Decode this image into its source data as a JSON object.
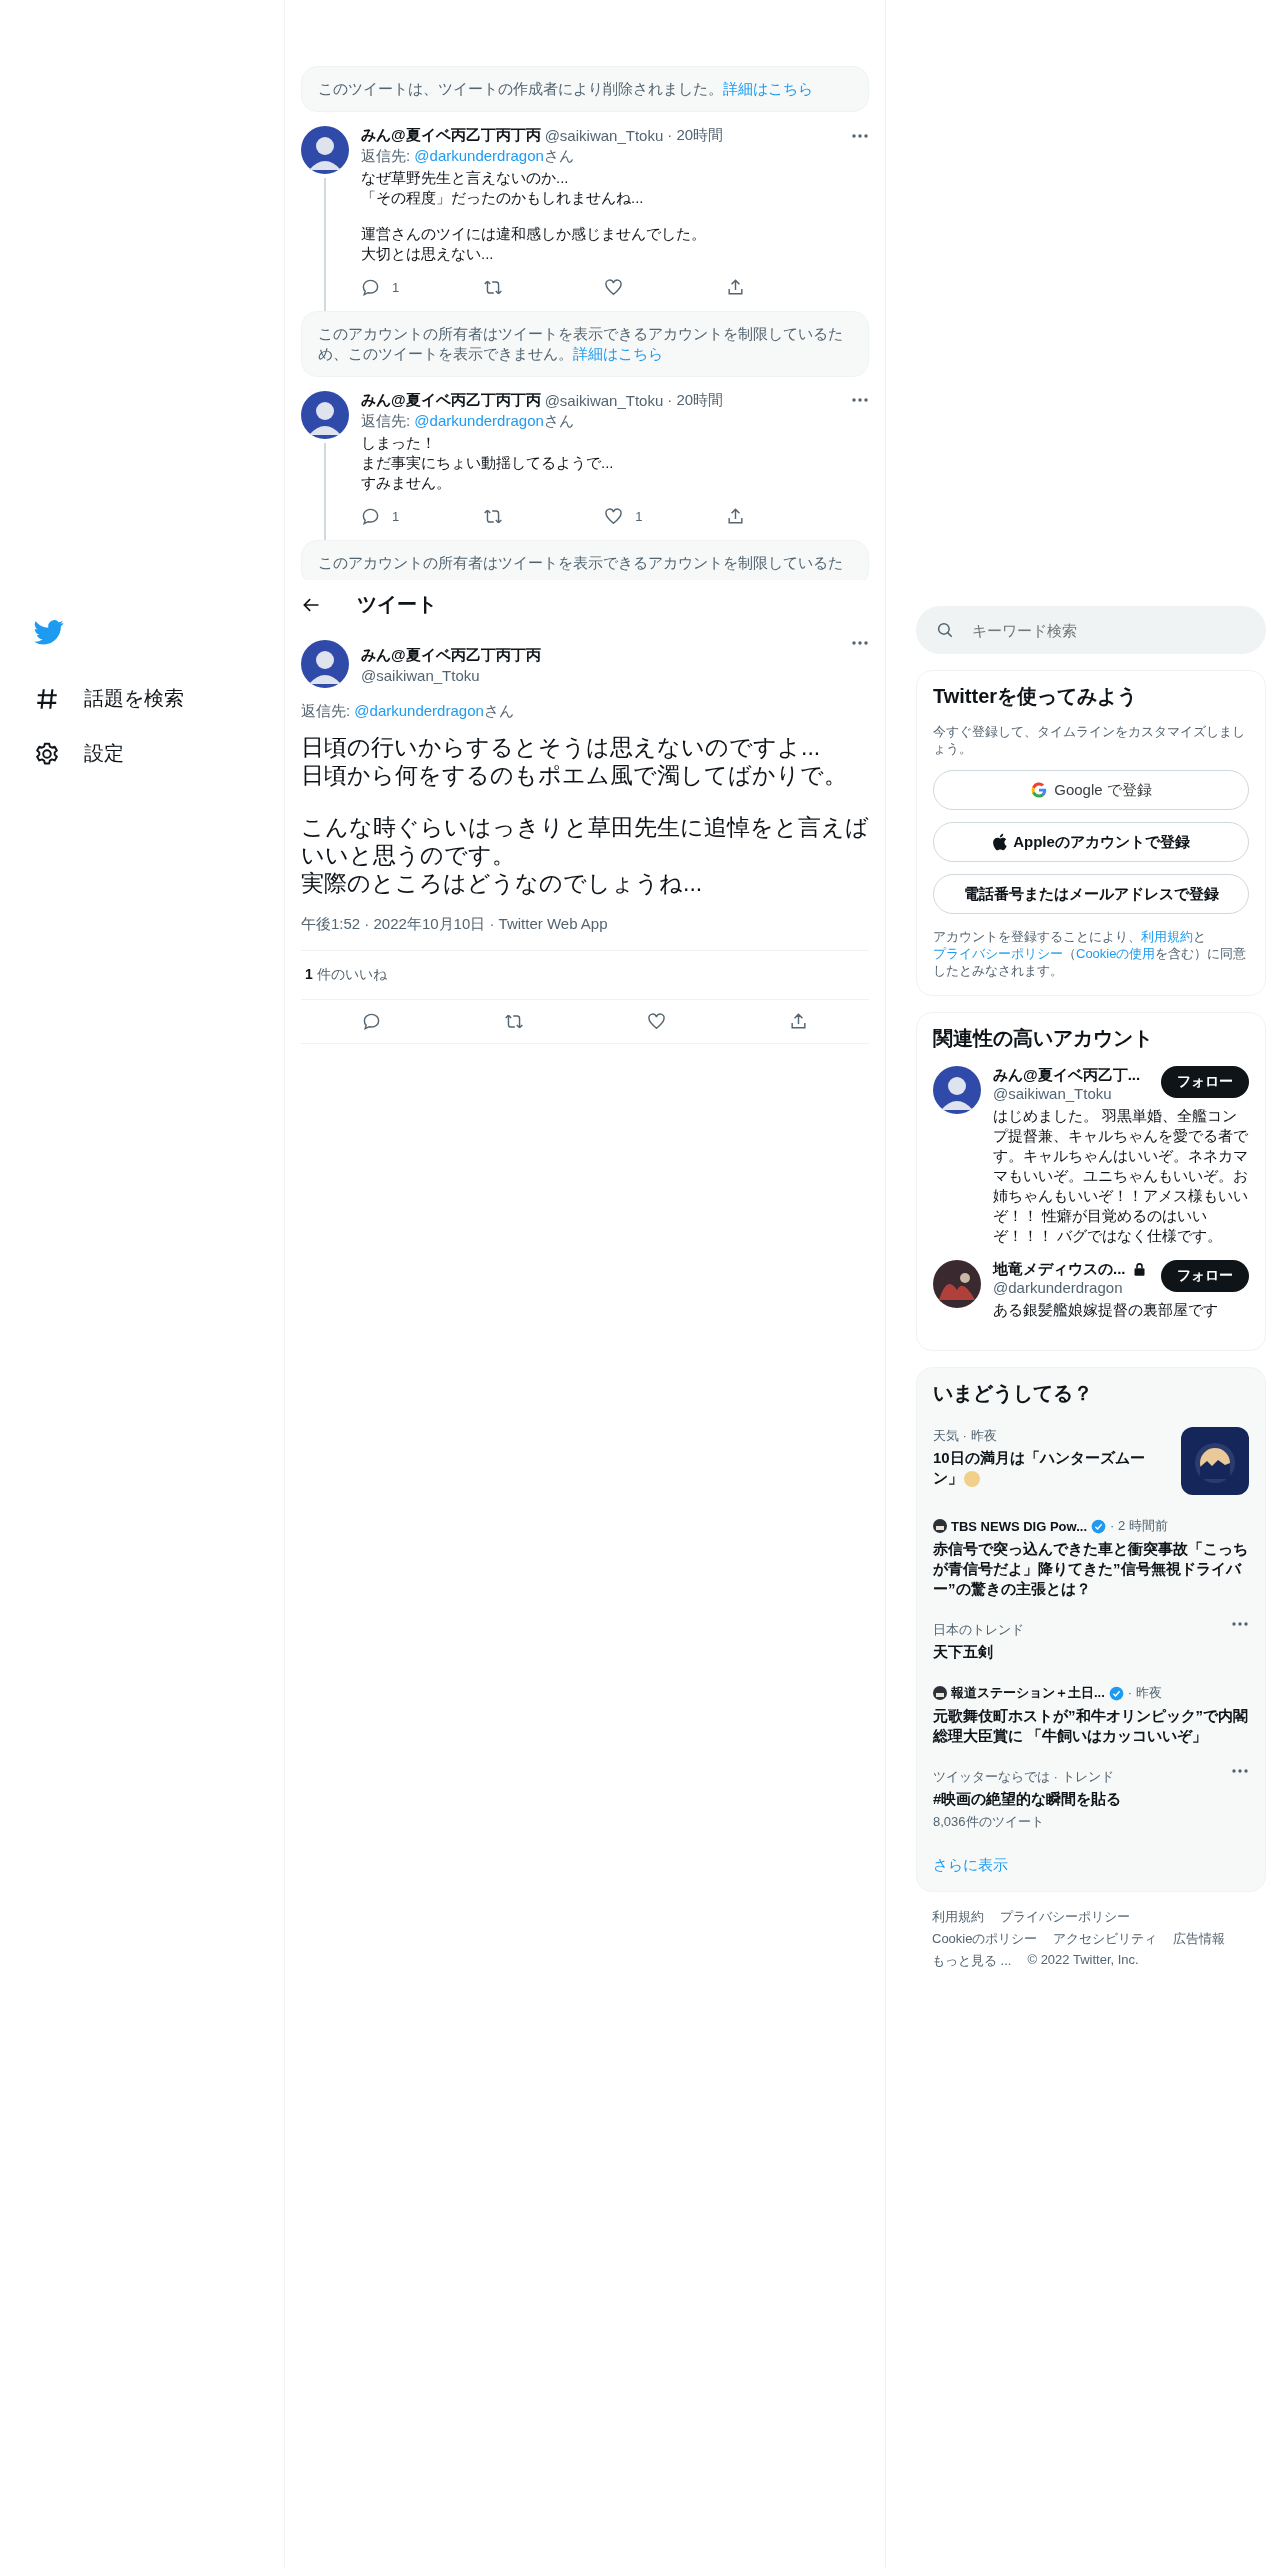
{
  "sidebar": {
    "items": [
      {
        "label": "話題を検索"
      },
      {
        "label": "設定"
      }
    ]
  },
  "thread": [
    {
      "kind": "notice",
      "text": "このツイートは、ツイートの作成者により削除されました。",
      "link": "詳細はこちら"
    },
    {
      "kind": "tweet",
      "name": "みん@夏イベ丙乙丁丙丁丙",
      "handle": "@saikiwan_Ttoku",
      "time": "· 20時間",
      "reply_prefix": "返信先: ",
      "reply_to": "@darkunderdragon",
      "reply_suffix": "さん",
      "body": [
        [
          "なぜ草野先生と言えないのか...",
          "「その程度」だったのかもしれませんね..."
        ],
        [
          "運営さんのツイには違和感しか感じませんでした。",
          "大切とは思えない..."
        ]
      ],
      "reply_count": "1"
    },
    {
      "kind": "notice",
      "text": "このアカウントの所有者はツイートを表示できるアカウントを制限しているため、このツイートを表示できません。",
      "link": "詳細はこちら"
    },
    {
      "kind": "tweet",
      "name": "みん@夏イベ丙乙丁丙丁丙",
      "handle": "@saikiwan_Ttoku",
      "time": "· 20時間",
      "reply_prefix": "返信先: ",
      "reply_to": "@darkunderdragon",
      "reply_suffix": "さん",
      "body": [
        [
          "しまった！",
          "まだ事実にちょい動揺してるようで...",
          "すみません。"
        ]
      ],
      "reply_count": "1",
      "like_count": "1"
    },
    {
      "kind": "notice",
      "text": "このアカウントの所有者はツイートを表示できるアカウントを制限しているた"
    }
  ],
  "header": {
    "title": "ツイート"
  },
  "main_tweet": {
    "name": "みん@夏イベ丙乙丁丙丁丙",
    "handle": "@saikiwan_Ttoku",
    "reply_prefix": "返信先: ",
    "reply_to": "@darkunderdragon",
    "reply_suffix": "さん",
    "body": [
      [
        "日頃の行いからするとそうは思えないのですよ...",
        "日頃から何をするのもポエム風で濁してばかりで。"
      ],
      [
        "こんな時ぐらいはっきりと草田先生に追悼をと言えばいいと思うのです。",
        "実際のところはどうなのでしょうね..."
      ]
    ],
    "timestamp": "午後1:52 · 2022年10月10日 · Twitter Web App",
    "like_count": "1",
    "like_label": "件のいいね"
  },
  "search": {
    "placeholder": "キーワード検索"
  },
  "signup": {
    "title": "Twitterを使ってみよう",
    "subtitle": "今すぐ登録して、タイムラインをカスタマイズしましょう。",
    "buttons": [
      {
        "kind": "google",
        "label": "Google で登録"
      },
      {
        "kind": "apple",
        "label": "Appleのアカウントで登録"
      },
      {
        "kind": "plain",
        "label": "電話番号またはメールアドレスで登録"
      }
    ],
    "legal": [
      {
        "text": "アカウントを登録することにより、",
        "link": false
      },
      {
        "text": "利用規約",
        "link": true
      },
      {
        "text": "と",
        "link": false
      },
      {
        "text": "プライバシーポリシー",
        "link": true
      },
      {
        "text": "（",
        "link": false
      },
      {
        "text": "Cookieの使用",
        "link": true
      },
      {
        "text": "を含む）に同意したとみなされます。",
        "link": false
      }
    ]
  },
  "related": {
    "title": "関連性の高いアカウント",
    "accounts": [
      {
        "name": "みん@夏イベ丙乙丁...",
        "locked": false,
        "handle": "@saikiwan_Ttoku",
        "bio": "はじめました。 羽黒単婚、全艦コンプ提督兼、キャルちゃんを愛でる者です。キャルちゃんはいいぞ。ネネカママもいいぞ。ユニちゃんもいいぞ。お姉ちゃんもいいぞ！！アメス様もいいぞ！！ 性癖が目覚めるのはいいぞ！！！ バグではなく仕様です。",
        "follow": "フォロー"
      },
      {
        "name": "地竜メディウスの...",
        "locked": true,
        "handle": "@darkunderdragon",
        "bio": "ある銀髪艦娘嫁提督の裏部屋です",
        "follow": "フォロー"
      }
    ]
  },
  "trends": {
    "title": "いまどうしてる？",
    "items": [
      {
        "kind": "news_image",
        "meta": "天気 · 昨夜",
        "title": "10日の満月は「ハンターズムーン」"
      },
      {
        "kind": "news",
        "source": "TBS NEWS DIG Pow...",
        "verified": true,
        "time": "· 2 時間前",
        "title": "赤信号で突っ込んできた車と衝突事故「こっちが青信号だよ」降りてきた”信号無視ドライバー”の驚きの主張とは？"
      },
      {
        "kind": "trend",
        "meta": "日本のトレンド",
        "title": "天下五剣"
      },
      {
        "kind": "news",
        "source": "報道ステーション＋土日...",
        "verified": true,
        "time": "· 昨夜",
        "title": "元歌舞伎町ホストが”和牛オリンピック”で内閣総理大臣賞に 「牛飼いはカッコいいぞ」"
      },
      {
        "kind": "trend",
        "meta": "ツイッターならでは · トレンド",
        "title": "#映画の絶望的な瞬間を貼る",
        "count": "8,036件のツイート"
      }
    ],
    "more": "さらに表示"
  },
  "footer": {
    "links": [
      "利用規約",
      "プライバシーポリシー",
      "Cookieのポリシー",
      "アクセシビリティ",
      "広告情報",
      "もっと見る ..."
    ],
    "copyright": "© 2022 Twitter, Inc."
  }
}
